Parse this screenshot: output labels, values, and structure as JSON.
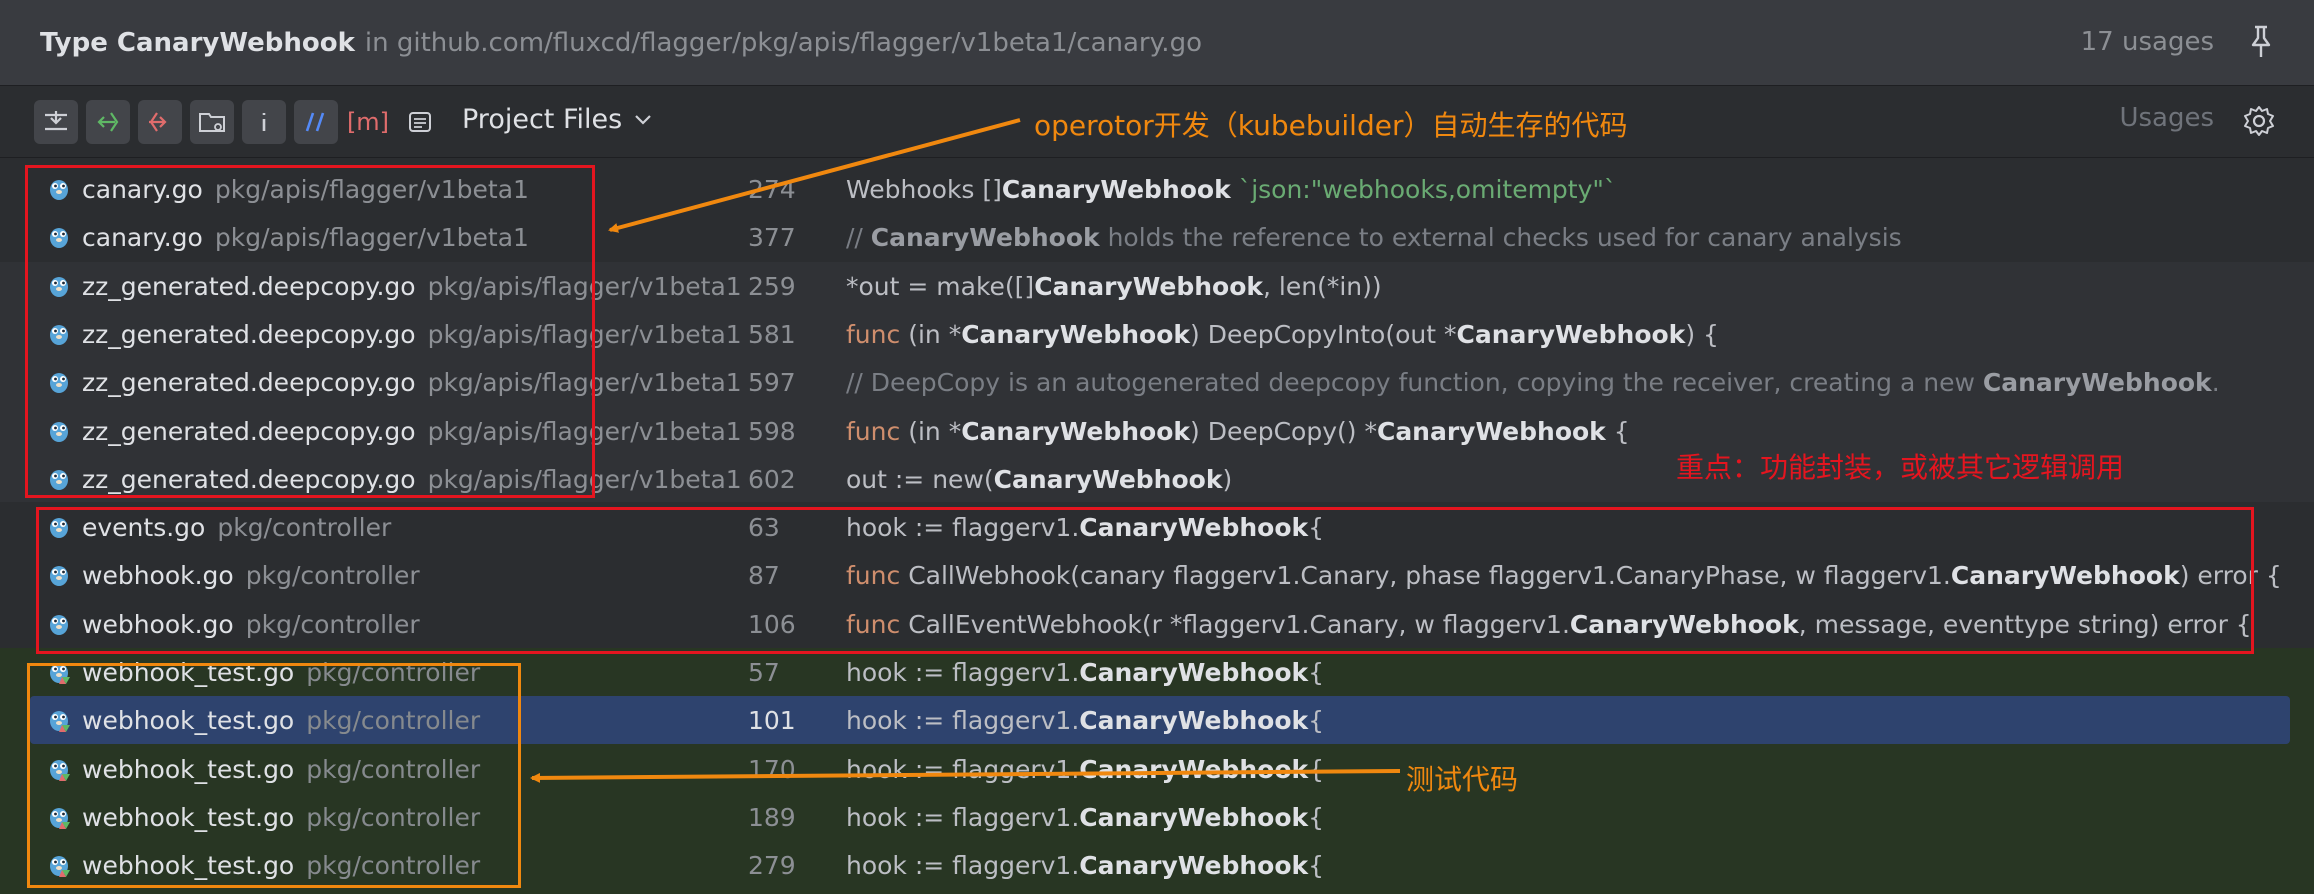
{
  "header": {
    "title": "Type CanaryWebhook",
    "location": "in github.com/fluxcd/flagger/pkg/apis/flagger/v1beta1/canary.go",
    "usages": "17 usages"
  },
  "toolbar": {
    "settings_label": "[m]",
    "scope": "Project Files",
    "usages_label": "Usages"
  },
  "annotations": {
    "operator": "operotor开发（kubebuilder）自动生存的代码",
    "focus": "重点：功能封装，或被其它逻辑调用",
    "tests": "测试代码"
  },
  "colors": {
    "selection": "#2e436e",
    "red_box": "#e4151f",
    "orange_box": "#f0880f",
    "test_bg": "#283623"
  },
  "rows": [
    {
      "file": "canary.go",
      "path": "pkg/apis/flagger/v1beta1",
      "line": "274",
      "code": [
        {
          "t": "Webhooks []"
        },
        {
          "b": "CanaryWebhook"
        },
        {
          "t": " "
        },
        {
          "s": "`json:\"webhooks,omitempty\"`"
        }
      ]
    },
    {
      "file": "canary.go",
      "path": "pkg/apis/flagger/v1beta1",
      "line": "377",
      "code": [
        {
          "c": "// "
        },
        {
          "cb": "CanaryWebhook"
        },
        {
          "c": " holds the reference to external checks used for canary analysis"
        }
      ]
    },
    {
      "file": "zz_generated.deepcopy.go",
      "path": "pkg/apis/flagger/v1beta1",
      "line": "259",
      "code": [
        {
          "t": "*out = make([]"
        },
        {
          "b": "CanaryWebhook"
        },
        {
          "t": ", len(*in))"
        }
      ]
    },
    {
      "file": "zz_generated.deepcopy.go",
      "path": "pkg/apis/flagger/v1beta1",
      "line": "581",
      "code": [
        {
          "k": "func"
        },
        {
          "t": " (in *"
        },
        {
          "b": "CanaryWebhook"
        },
        {
          "t": ") DeepCopyInto(out *"
        },
        {
          "b": "CanaryWebhook"
        },
        {
          "t": ") {"
        }
      ]
    },
    {
      "file": "zz_generated.deepcopy.go",
      "path": "pkg/apis/flagger/v1beta1",
      "line": "597",
      "code": [
        {
          "c": "// DeepCopy is an autogenerated deepcopy function, copying the receiver, creating a new "
        },
        {
          "cb": "CanaryWebhook"
        },
        {
          "c": "."
        }
      ]
    },
    {
      "file": "zz_generated.deepcopy.go",
      "path": "pkg/apis/flagger/v1beta1",
      "line": "598",
      "code": [
        {
          "k": "func"
        },
        {
          "t": " (in *"
        },
        {
          "b": "CanaryWebhook"
        },
        {
          "t": ") DeepCopy() *"
        },
        {
          "b": "CanaryWebhook"
        },
        {
          "t": " {"
        }
      ]
    },
    {
      "file": "zz_generated.deepcopy.go",
      "path": "pkg/apis/flagger/v1beta1",
      "line": "602",
      "code": [
        {
          "t": "out := new("
        },
        {
          "b": "CanaryWebhook"
        },
        {
          "t": ")"
        }
      ]
    },
    {
      "file": "events.go",
      "path": "pkg/controller",
      "line": "63",
      "code": [
        {
          "t": "hook := flaggerv1."
        },
        {
          "b": "CanaryWebhook"
        },
        {
          "t": "{"
        }
      ]
    },
    {
      "file": "webhook.go",
      "path": "pkg/controller",
      "line": "87",
      "code": [
        {
          "k": "func"
        },
        {
          "t": " CallWebhook(canary flaggerv1.Canary, phase flaggerv1.CanaryPhase, w flaggerv1."
        },
        {
          "b": "CanaryWebhook"
        },
        {
          "t": ") error {"
        }
      ]
    },
    {
      "file": "webhook.go",
      "path": "pkg/controller",
      "line": "106",
      "code": [
        {
          "k": "func"
        },
        {
          "t": " CallEventWebhook(r *flaggerv1.Canary, w flaggerv1."
        },
        {
          "b": "CanaryWebhook"
        },
        {
          "t": ", message, eventtype string) error {"
        }
      ]
    },
    {
      "file": "webhook_test.go",
      "path": "pkg/controller",
      "line": "57",
      "code": [
        {
          "t": "hook := flaggerv1."
        },
        {
          "b": "CanaryWebhook"
        },
        {
          "t": "{"
        }
      ]
    },
    {
      "file": "webhook_test.go",
      "path": "pkg/controller",
      "line": "101",
      "code": [
        {
          "t": "hook := flaggerv1."
        },
        {
          "b": "CanaryWebhook"
        },
        {
          "t": "{"
        }
      ]
    },
    {
      "file": "webhook_test.go",
      "path": "pkg/controller",
      "line": "170",
      "code": [
        {
          "t": "hook := flaggerv1."
        },
        {
          "b": "CanaryWebhook"
        },
        {
          "t": "{"
        }
      ]
    },
    {
      "file": "webhook_test.go",
      "path": "pkg/controller",
      "line": "189",
      "code": [
        {
          "t": "hook := flaggerv1."
        },
        {
          "b": "CanaryWebhook"
        },
        {
          "t": "{"
        }
      ]
    },
    {
      "file": "webhook_test.go",
      "path": "pkg/controller",
      "line": "279",
      "code": [
        {
          "t": "hook := flaggerv1."
        },
        {
          "b": "CanaryWebhook"
        },
        {
          "t": "{"
        }
      ]
    }
  ]
}
